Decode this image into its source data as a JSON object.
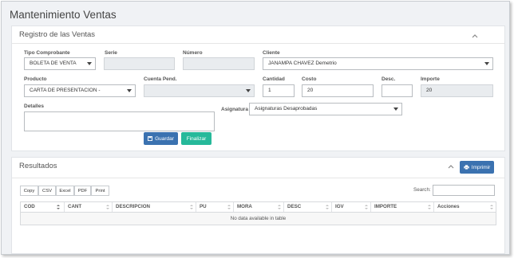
{
  "page": {
    "title": "Mantenimiento Ventas"
  },
  "registro": {
    "title": "Registro de las Ventas",
    "tipo_comprobante": {
      "label": "Tipo Comprobante",
      "value": "BOLETA DE VENTA"
    },
    "serie": {
      "label": "Serie",
      "value": ""
    },
    "numero": {
      "label": "Número",
      "value": ""
    },
    "cliente": {
      "label": "Cliente",
      "value": "JANAMPA CHAVEZ Demetrio"
    },
    "producto": {
      "label": "Producto",
      "value": "CARTA DE PRESENTACION -"
    },
    "cuenta_pend": {
      "label": "Cuenta Pend.",
      "value": ""
    },
    "cantidad": {
      "label": "Cantidad",
      "value": "1"
    },
    "costo": {
      "label": "Costo",
      "value": "20"
    },
    "desc": {
      "label": "Desc.",
      "value": ""
    },
    "importe": {
      "label": "Importe",
      "value": "20"
    },
    "detalles": {
      "label": "Detalles",
      "value": ""
    },
    "asignatura": {
      "label": "Asignatura",
      "value": "Asignaturas Desaprobadas"
    },
    "guardar_label": "Guardar",
    "finalizar_label": "Finalizar"
  },
  "resultados": {
    "title": "Resultados",
    "imprimir_label": "Imprimir",
    "export_buttons": [
      "Copy",
      "CSV",
      "Excel",
      "PDF",
      "Print"
    ],
    "search_label": "Search:",
    "columns": [
      "COD",
      "CANT",
      "DESCRIPCION",
      "PU",
      "MORA",
      "DESC",
      "IGV",
      "IMPORTE",
      "Acciones"
    ],
    "empty_message": "No data available in table"
  },
  "colors": {
    "primary": "#3b72b0",
    "success": "#26b99a",
    "background": "#f0f2f5"
  }
}
